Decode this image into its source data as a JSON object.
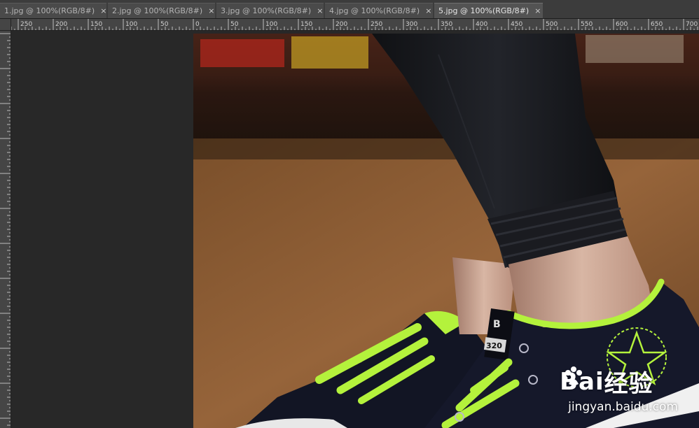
{
  "tabs": [
    {
      "label": "1.jpg @ 100%(RGB/8#)",
      "active": false
    },
    {
      "label": "2.jpg @ 100%(RGB/8#)",
      "active": false
    },
    {
      "label": "3.jpg @ 100%(RGB/8#)",
      "active": false
    },
    {
      "label": "4.jpg @ 100%(RGB/8#)",
      "active": false
    },
    {
      "label": "5.jpg @ 100%(RGB/8#)",
      "active": true
    }
  ],
  "close_glyph": "×",
  "ruler": {
    "horizontal_labels": [
      "250",
      "200",
      "150",
      "100",
      "50",
      "0",
      "50",
      "100",
      "150",
      "200",
      "250",
      "300",
      "350",
      "400",
      "450",
      "500",
      "550",
      "600",
      "650",
      "700"
    ]
  },
  "watermark": {
    "brand_left": "Bai",
    "brand_right": "经验",
    "url": "jingyan.baidu.com"
  },
  "image": {
    "shoe_logo_top": "B",
    "shoe_logo_num": "320"
  },
  "colors": {
    "lace_green": "#b4f23c",
    "shoe_navy": "#15182a",
    "floor_brown": "#8a5a2b",
    "pants_black": "#141518"
  }
}
